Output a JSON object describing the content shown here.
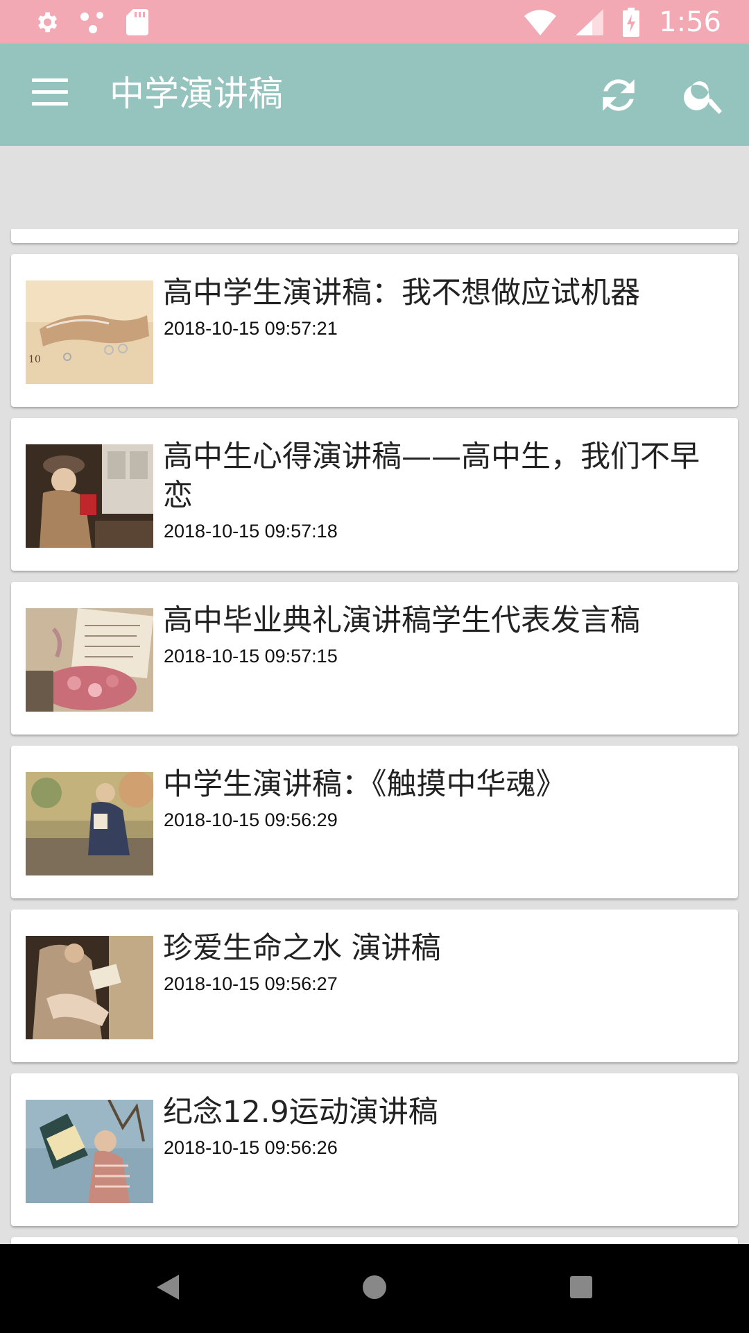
{
  "status_bar": {
    "time": "1:56",
    "left_icons": [
      "settings-icon",
      "dots-icon",
      "sd-card-icon"
    ],
    "right_icons": [
      "wifi-icon",
      "signal-icon",
      "battery-charging-icon"
    ]
  },
  "app_bar": {
    "title": "中学演讲稿",
    "menu_icon": "menu-icon",
    "refresh_icon": "refresh-icon",
    "search_icon": "search-icon",
    "background_color": "#95c4bf"
  },
  "articles": [
    {
      "title": "高中学生演讲稿：我不想做应试机器",
      "time": "2018-10-15 09:57:21"
    },
    {
      "title": "高中生心得演讲稿——高中生，我们不早恋",
      "time": "2018-10-15 09:57:18"
    },
    {
      "title": "高中毕业典礼演讲稿学生代表发言稿",
      "time": "2018-10-15 09:57:15"
    },
    {
      "title": "中学生演讲稿：《触摸中华魂》",
      "time": "2018-10-15 09:56:29"
    },
    {
      "title": "珍爱生命之水 演讲稿",
      "time": "2018-10-15 09:56:27"
    },
    {
      "title": "纪念12.9运动演讲稿",
      "time": "2018-10-15 09:56:26"
    }
  ],
  "nav_bar": {
    "back_icon": "back-triangle-icon",
    "home_icon": "home-circle-icon",
    "recent_icon": "recent-square-icon"
  }
}
